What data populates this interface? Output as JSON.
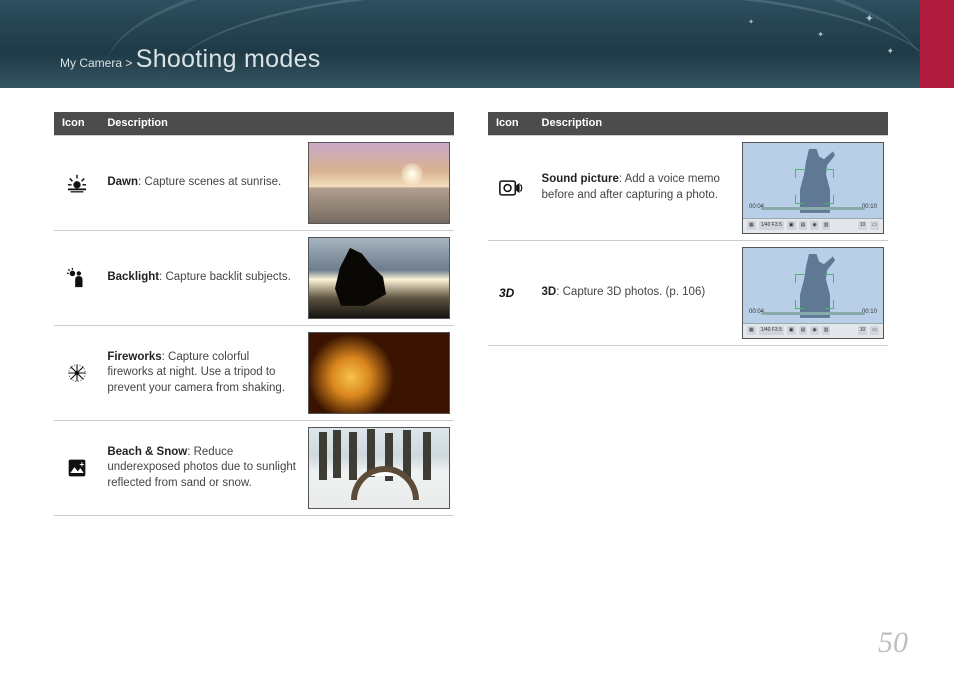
{
  "breadcrumb": {
    "section": "My Camera",
    "sep": ">",
    "title": "Shooting modes"
  },
  "tableHeaders": {
    "icon": "Icon",
    "desc": "Description"
  },
  "left": [
    {
      "icon": "dawn-icon",
      "term": "Dawn",
      "text": ": Capture scenes at sunrise.",
      "thumb": "dawn"
    },
    {
      "icon": "backlight-icon",
      "term": "Backlight",
      "text": ": Capture backlit subjects.",
      "thumb": "back"
    },
    {
      "icon": "fireworks-icon",
      "term": "Fireworks",
      "text": ": Capture colorful fireworks at night. Use a tripod to prevent your camera from shaking.",
      "thumb": "fire"
    },
    {
      "icon": "beachsnow-icon",
      "term": "Beach & Snow",
      "text": ": Reduce underexposed photos due to sunlight reflected from sand or snow.",
      "thumb": "snow"
    }
  ],
  "right": [
    {
      "icon": "soundpic-icon",
      "term": "Sound picture",
      "text": ": Add a voice memo before and after capturing a photo.",
      "thumb": "lcd"
    },
    {
      "icon": "3d-icon",
      "term": "3D",
      "text": ": Capture 3D photos. (p. 106)",
      "thumb": "lcd"
    }
  ],
  "lcd": {
    "left": "00:04",
    "right": "00:10",
    "info": "1/40 F3.5"
  },
  "pageNumber": "50"
}
